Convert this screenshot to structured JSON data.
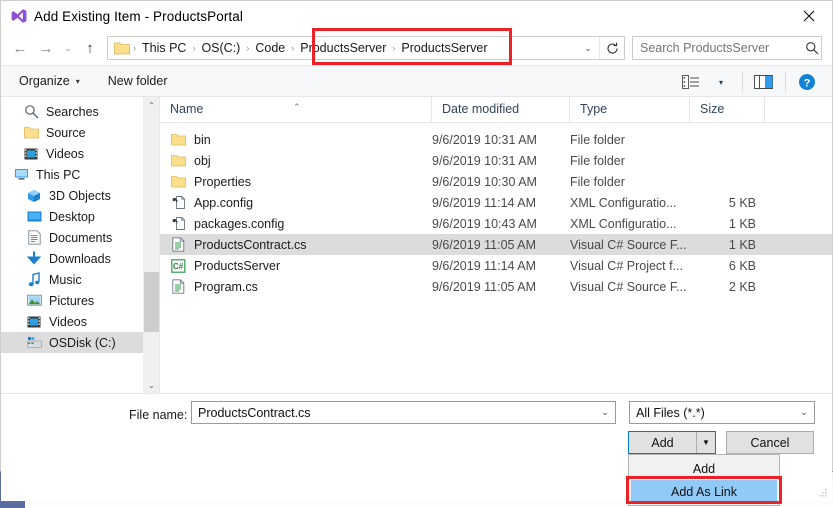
{
  "window": {
    "title": "Add Existing Item - ProductsPortal",
    "icon": "visual-studio-icon",
    "close_label": "✕"
  },
  "nav": {
    "back": "←",
    "forward": "→",
    "recent": "⌄",
    "up": "↑",
    "refresh": "↻",
    "dropdown": "⌄",
    "breadcrumbs": [
      {
        "label": "This PC"
      },
      {
        "label": "OS(C:)"
      },
      {
        "label": "Code"
      },
      {
        "label": "ProductsServer"
      },
      {
        "label": "ProductsServer"
      }
    ],
    "separator": "›"
  },
  "search": {
    "placeholder": "Search ProductsServer",
    "value": "",
    "icon": "search-icon"
  },
  "command_bar": {
    "organize": "Organize",
    "organize_caret": "▾",
    "new_folder": "New folder",
    "view_caret": "▾",
    "view_icon": "list-view-icon",
    "preview_icon": "preview-pane-icon",
    "help_icon": "help-icon"
  },
  "sidebar": {
    "items": [
      {
        "label": "Searches",
        "icon": "search-folder-icon",
        "level": 1,
        "selected": false
      },
      {
        "label": "Source",
        "icon": "folder-icon",
        "level": 1,
        "selected": false
      },
      {
        "label": "Videos",
        "icon": "videos-icon",
        "level": 1,
        "selected": false
      },
      {
        "label": "This PC",
        "icon": "this-pc-icon",
        "level": 0,
        "selected": false
      },
      {
        "label": "3D Objects",
        "icon": "3d-objects-icon",
        "level": 1,
        "selected": false
      },
      {
        "label": "Desktop",
        "icon": "desktop-icon",
        "level": 1,
        "selected": false
      },
      {
        "label": "Documents",
        "icon": "documents-icon",
        "level": 1,
        "selected": false
      },
      {
        "label": "Downloads",
        "icon": "downloads-icon",
        "level": 1,
        "selected": false
      },
      {
        "label": "Music",
        "icon": "music-icon",
        "level": 1,
        "selected": false
      },
      {
        "label": "Pictures",
        "icon": "pictures-icon",
        "level": 1,
        "selected": false
      },
      {
        "label": "Videos",
        "icon": "videos-icon",
        "level": 1,
        "selected": false
      },
      {
        "label": "OSDisk (C:)",
        "icon": "disk-icon",
        "level": 1,
        "selected": true
      }
    ],
    "scroll_up": "⌃",
    "scroll_down": "⌄"
  },
  "filelist": {
    "columns": [
      {
        "key": "name",
        "label": "Name",
        "sorted": true,
        "sort_glyph": "⌃"
      },
      {
        "key": "date",
        "label": "Date modified"
      },
      {
        "key": "type",
        "label": "Type"
      },
      {
        "key": "size",
        "label": "Size"
      }
    ],
    "rows": [
      {
        "name": "bin",
        "icon": "folder-icon",
        "date": "9/6/2019 10:31 AM",
        "type": "File folder",
        "size": "",
        "selected": false
      },
      {
        "name": "obj",
        "icon": "folder-icon",
        "date": "9/6/2019 10:31 AM",
        "type": "File folder",
        "size": "",
        "selected": false
      },
      {
        "name": "Properties",
        "icon": "folder-icon",
        "date": "9/6/2019 10:30 AM",
        "type": "File folder",
        "size": "",
        "selected": false
      },
      {
        "name": "App.config",
        "icon": "config-file-icon",
        "date": "9/6/2019 11:14 AM",
        "type": "XML Configuratio...",
        "size": "5 KB",
        "selected": false
      },
      {
        "name": "packages.config",
        "icon": "config-file-icon",
        "date": "9/6/2019 10:43 AM",
        "type": "XML Configuratio...",
        "size": "1 KB",
        "selected": false
      },
      {
        "name": "ProductsContract.cs",
        "icon": "cs-file-icon",
        "date": "9/6/2019 11:05 AM",
        "type": "Visual C# Source F...",
        "size": "1 KB",
        "selected": true
      },
      {
        "name": "ProductsServer",
        "icon": "csproj-icon",
        "date": "9/6/2019 11:14 AM",
        "type": "Visual C# Project f...",
        "size": "6 KB",
        "selected": false
      },
      {
        "name": "Program.cs",
        "icon": "cs-file-icon",
        "date": "9/6/2019 11:05 AM",
        "type": "Visual C# Source F...",
        "size": "2 KB",
        "selected": false
      }
    ]
  },
  "footer": {
    "filename_label": "File name:",
    "filename_value": "ProductsContract.cs",
    "filename_placeholder": "",
    "filename_dropdown": "⌄",
    "filter_value": "All Files (*.*)",
    "filter_dropdown": "⌄",
    "add_button": "Add",
    "add_split_arrow": "▼",
    "cancel_button": "Cancel"
  },
  "dropdown_menu": {
    "items": [
      {
        "label": "Add",
        "highlighted": false
      },
      {
        "label": "Add As Link",
        "highlighted": true
      }
    ]
  },
  "annotations": {
    "highlight_color": "#ec2227",
    "boxes": [
      {
        "name": "breadcrumb-highlight"
      },
      {
        "name": "add-as-link-highlight"
      }
    ]
  }
}
